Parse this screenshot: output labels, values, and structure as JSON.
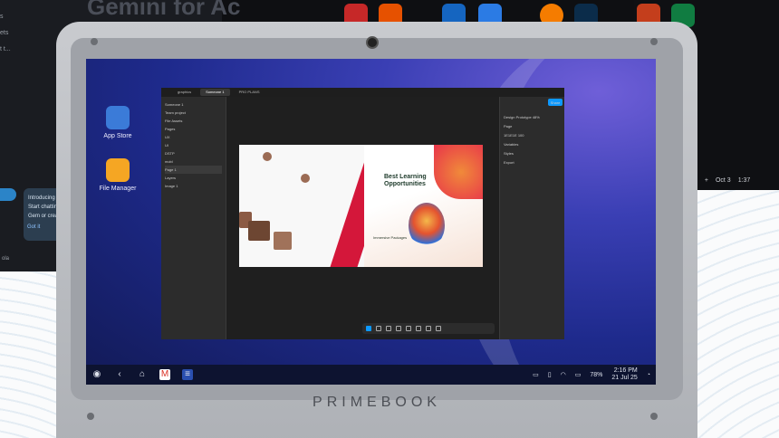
{
  "background": {
    "gemini_heading": "Gemini for Ac",
    "left_sidebar_fragments": [
      "s",
      "ets",
      "",
      "",
      "t t..."
    ],
    "intro_card_lines": [
      "Introducing G",
      "Start chatting",
      "Gem or create"
    ],
    "intro_card_button": "Got it",
    "left_bottom_text": "ola",
    "right_bar_items": [
      "Oct 3",
      "1:37"
    ]
  },
  "laptop": {
    "brand": "PRIMEBOOK"
  },
  "desktop": {
    "icons": [
      {
        "label": "App Store",
        "icon": "app-store-icon"
      },
      {
        "label": "File Manager",
        "icon": "folder-icon"
      }
    ]
  },
  "figma": {
    "tabs": [
      "graphics",
      "Someone 1",
      "PRO PLANS"
    ],
    "left_panel": {
      "project": "Someone 1",
      "subtitle": "Team project",
      "file_label": "File",
      "assets_label": "Assets",
      "pages_header": "Pages",
      "pages": [
        "UX",
        "UI",
        "DSTP",
        "mobl",
        "Page 1"
      ],
      "selected_page": "Page 1",
      "layers_header": "Layers",
      "layers": [
        "Image 1"
      ]
    },
    "right_panel": {
      "tabs": [
        "Design",
        "Prototype"
      ],
      "zoom": "48%",
      "share": "Share",
      "page_label": "Page",
      "page_color": "1E1E1E",
      "page_opacity": "100",
      "sections": [
        "Variables",
        "Styles",
        "Export"
      ]
    },
    "canvas": {
      "hero_title": "Best Learning Opportunities",
      "subhead": "Immersive Packages"
    }
  },
  "taskbar": {
    "battery": "78%",
    "time": "2:16 PM",
    "date": "21 Jul 25"
  },
  "colors": {
    "accent": "#0d99ff",
    "brand_red": "#d4173a"
  }
}
